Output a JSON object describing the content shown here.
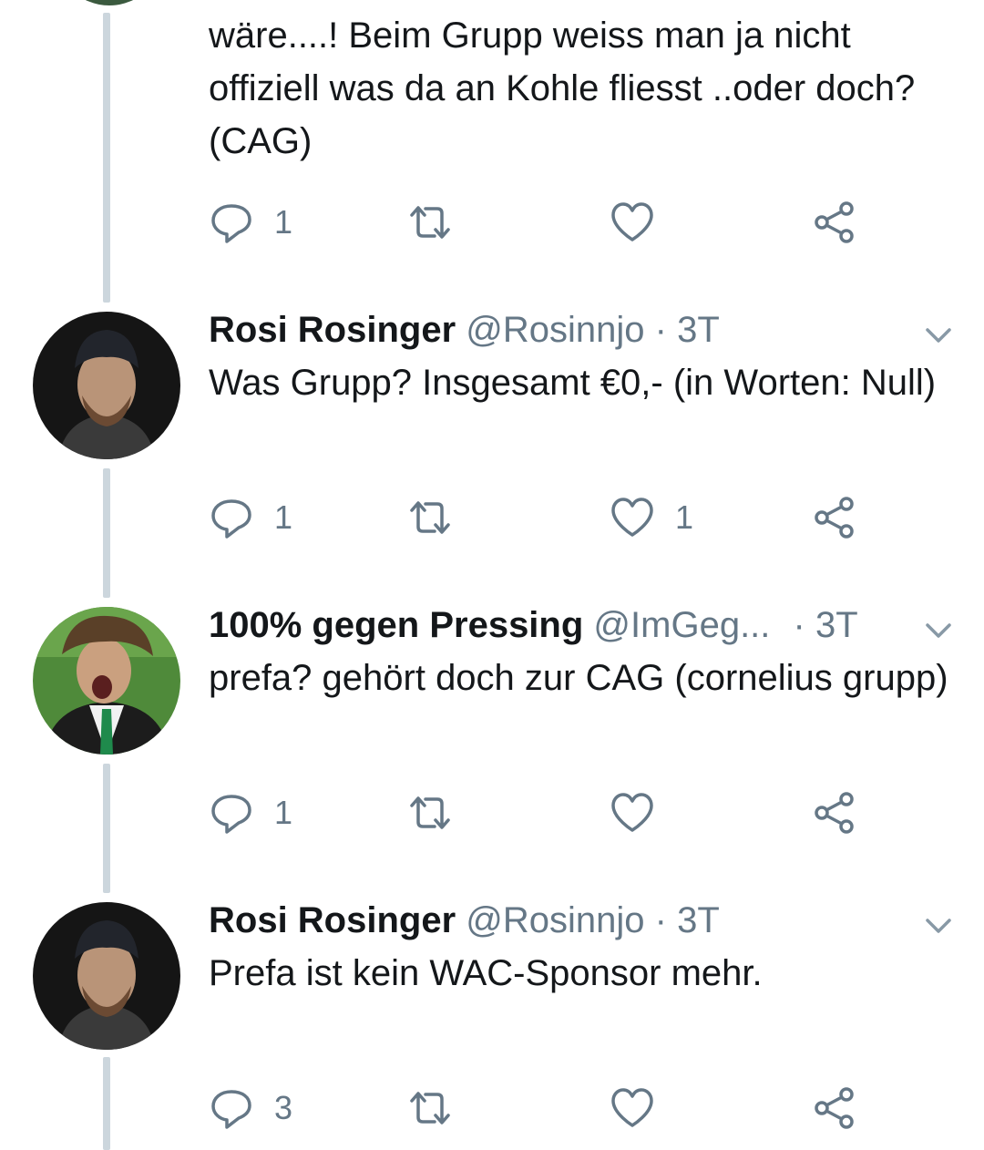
{
  "first_tweet": {
    "text": "wäre....! Beim Grupp weiss man ja nicht offiziell was da an Kohle fliesst ..oder doch? (CAG)",
    "reply_count": "1",
    "like_count": ""
  },
  "tweets": [
    {
      "name": "Rosi Rosinger",
      "handle": "@Rosinnjo",
      "separator": "·",
      "time": "3T",
      "text": "Was Grupp? Insgesamt €0,- (in Worten: Null)",
      "reply_count": "1",
      "like_count": "1"
    },
    {
      "name": "100% gegen Pressing",
      "handle": "@ImGeg...",
      "separator": "·",
      "time": "3T",
      "text": "prefa? gehört doch zur CAG (cornelius grupp)",
      "reply_count": "1",
      "like_count": ""
    },
    {
      "name": "Rosi Rosinger",
      "handle": "@Rosinnjo",
      "separator": "·",
      "time": "3T",
      "text": "Prefa ist kein WAC-Sponsor mehr.",
      "reply_count": "3",
      "like_count": ""
    }
  ],
  "icons": {
    "reply": "reply-icon",
    "retweet": "retweet-icon",
    "like": "heart-icon",
    "share": "share-icon",
    "caret": "chevron-down-icon"
  },
  "colors": {
    "text": "#14171a",
    "secondary": "#657786",
    "thread_line": "#ccd6dd"
  }
}
